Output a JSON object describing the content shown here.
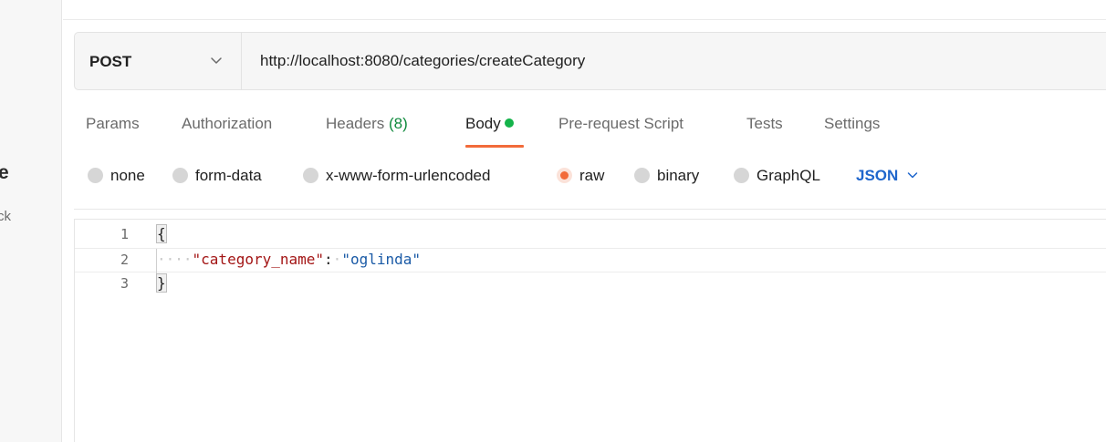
{
  "sidebar": {
    "fragment_large": "e",
    "fragment_small": "ck"
  },
  "request": {
    "method": "POST",
    "url": "http://localhost:8080/categories/createCategory"
  },
  "tabs": [
    {
      "label": "Params"
    },
    {
      "label": "Authorization"
    },
    {
      "label": "Headers",
      "count": "(8)"
    },
    {
      "label": "Body",
      "active": true,
      "indicator_color": "#14b34a"
    },
    {
      "label": "Pre-request Script"
    },
    {
      "label": "Tests"
    },
    {
      "label": "Settings"
    }
  ],
  "body_types": [
    {
      "label": "none",
      "selected": false
    },
    {
      "label": "form-data",
      "selected": false
    },
    {
      "label": "x-www-form-urlencoded",
      "selected": false
    },
    {
      "label": "raw",
      "selected": true
    },
    {
      "label": "binary",
      "selected": false
    },
    {
      "label": "GraphQL",
      "selected": false
    }
  ],
  "format": {
    "selected": "JSON"
  },
  "editor": {
    "lines": [
      {
        "number": "1",
        "open_brace": "{"
      },
      {
        "number": "2",
        "key": "\"category_name\"",
        "colon": ":",
        "value": "\"oglinda\""
      },
      {
        "number": "3",
        "close_brace": "}"
      }
    ]
  },
  "colors": {
    "accent": "#f26b3a",
    "body_indicator": "#14b34a",
    "json_label": "#1f66cc",
    "headers_count": "#0f8a3d"
  },
  "icons": {
    "method_dropdown": "chevron-down-icon",
    "format_dropdown": "chevron-down-icon"
  }
}
